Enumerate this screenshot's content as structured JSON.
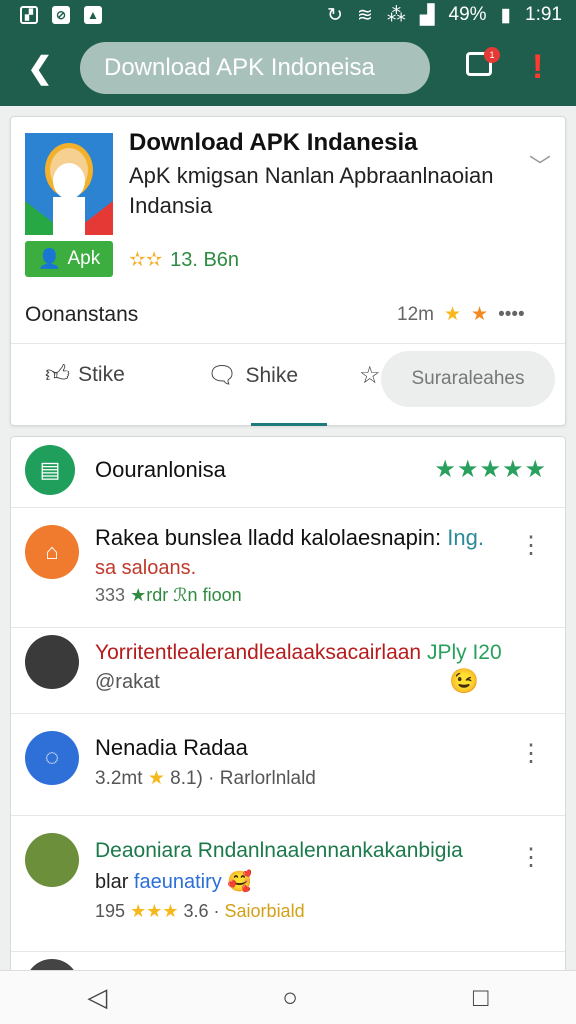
{
  "status": {
    "percent": "49%",
    "time": "1:91"
  },
  "appbar": {
    "url": "Download APK Indoneisa",
    "tabs_badge": "1"
  },
  "app": {
    "title": "Download APK Indanesia",
    "subtitle": "ApK kmigsan Nanlan Apbraanlnaoian Indansia",
    "badge": "Apk",
    "rating_text": "13. B6n",
    "developer": "Oonanstans",
    "size": "12m",
    "dots": "••••",
    "actions": {
      "like": "Stike",
      "share": "Shike",
      "save": "Suraraleahes"
    }
  },
  "list": {
    "header": {
      "title": "Oouranlonisa",
      "stars": "★★★★★"
    },
    "rows": [
      {
        "title": "Rakea bunslea lladd kalolaesnapin:",
        "title_accent": "Ing.",
        "line2": "sa saloans.",
        "meta_count": "333",
        "meta_text": "★rdr ℛn fioon"
      },
      {
        "title": "Yorritentlealerandlealaaksacairlaan",
        "title_accent": "JPly I20",
        "line2": "@rakat"
      },
      {
        "title": "Nenadia Radaa",
        "meta_count": "3.2mt",
        "meta_rating": "8.1)",
        "meta_text": "Rarlorlnlald"
      },
      {
        "title": "Deaoniara Rndanlnaalennankakanbigia",
        "line2": "blar",
        "line2_accent": "faeunatiry",
        "meta_count": "195",
        "meta_rating": "3.6",
        "meta_text": "Saiorbiald"
      }
    ]
  },
  "colors": {
    "appbar": "#1f5e4d",
    "accent_green": "#2aa05e",
    "star_yellow": "#f6b81a",
    "alert": "#ff3b30"
  }
}
